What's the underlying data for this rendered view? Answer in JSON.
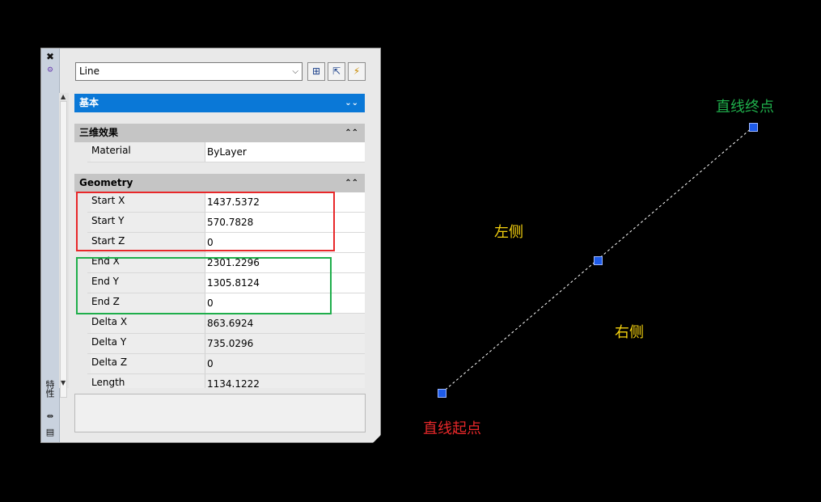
{
  "palette": {
    "title": "特性",
    "object_type": "Line",
    "tools": {
      "pickadd": "toggle-pickadd-icon",
      "select": "select-objects-icon",
      "quickselect": "quick-select-icon"
    },
    "sections": {
      "basic": "基本",
      "threed": "三维效果",
      "geometry": "Geometry"
    },
    "threed_props": [
      {
        "name": "Material",
        "value": "ByLayer"
      }
    ],
    "geometry_props": [
      {
        "name": "Start X",
        "value": "1437.5372"
      },
      {
        "name": "Start Y",
        "value": "570.7828"
      },
      {
        "name": "Start Z",
        "value": "0"
      },
      {
        "name": "End X",
        "value": "2301.2296"
      },
      {
        "name": "End Y",
        "value": "1305.8124"
      },
      {
        "name": "End Z",
        "value": "0"
      },
      {
        "name": "Delta X",
        "value": "863.6924"
      },
      {
        "name": "Delta Y",
        "value": "735.0296"
      },
      {
        "name": "Delta Z",
        "value": "0"
      },
      {
        "name": "Length",
        "value": "1134.1222"
      }
    ]
  },
  "canvas": {
    "label_end": "直线终点",
    "label_start": "直线起点",
    "label_left": "左侧",
    "label_right": "右侧"
  },
  "colors": {
    "label_end": "#1fae4b",
    "label_start": "#e8282a",
    "label_side": "#f5d20f",
    "highlight_start": "#e8282a",
    "highlight_end": "#1fae4b",
    "grip": "#1e5be8"
  }
}
